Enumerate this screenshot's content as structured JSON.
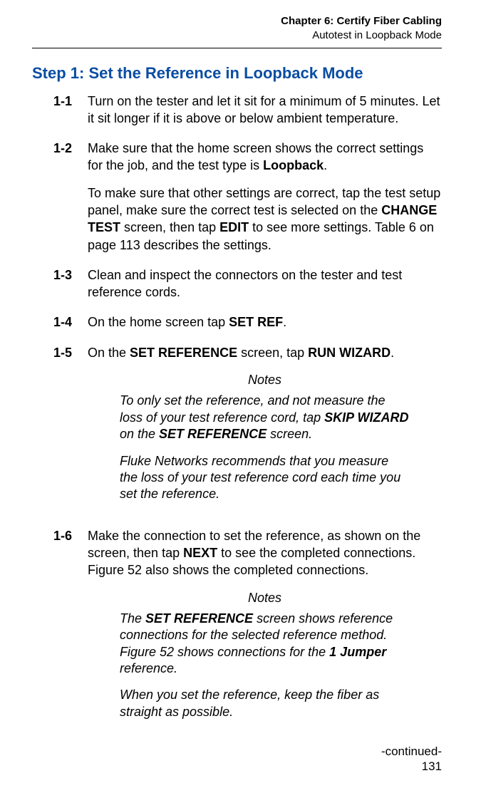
{
  "header": {
    "chapter": "Chapter 6: Certify Fiber Cabling",
    "section": "Autotest in Loopback Mode"
  },
  "title": "Step 1: Set the Reference in Loopback Mode",
  "steps": {
    "s1": {
      "num": "1-1",
      "p1": "Turn on the tester and let it sit for a minimum of 5 minutes. Let it sit longer if it is above or below ambient temperature."
    },
    "s2": {
      "num": "1-2",
      "p1a": "Make sure that the home screen shows the correct settings for the job, and the test type is ",
      "p1b": "Loopback",
      "p1c": ".",
      "p2a": "To make sure that other settings are correct, tap the test setup panel, make sure the correct test is selected on the ",
      "p2b": "CHANGE TEST",
      "p2c": " screen, then tap ",
      "p2d": "EDIT",
      "p2e": " to see more settings. Table 6 on page 113 describes the settings."
    },
    "s3": {
      "num": "1-3",
      "p1": "Clean and inspect the connectors on the tester and test reference cords."
    },
    "s4": {
      "num": "1-4",
      "p1a": "On the home screen tap ",
      "p1b": "SET REF",
      "p1c": "."
    },
    "s5": {
      "num": "1-5",
      "p1a": "On the ",
      "p1b": "SET REFERENCE",
      "p1c": " screen, tap ",
      "p1d": "RUN WIZARD",
      "p1e": "."
    },
    "s6": {
      "num": "1-6",
      "p1a": "Make the connection to set the reference, as shown on the screen, then tap ",
      "p1b": "NEXT",
      "p1c": " to see the completed connections. Figure 52 also shows the completed connections."
    }
  },
  "notes1": {
    "heading": "Notes",
    "p1a": "To only set the reference, and not measure the loss of your test reference cord, tap ",
    "p1b": "SKIP WIZARD",
    "p1c": " on the ",
    "p1d": "SET REFERENCE",
    "p1e": " screen.",
    "p2": "Fluke Networks recommends that you measure the loss of your test reference cord each time you set the reference."
  },
  "notes2": {
    "heading": "Notes",
    "p1a": "The ",
    "p1b": "SET REFERENCE",
    "p1c": " screen shows reference connections for the selected reference method. Figure 52 shows connections for the ",
    "p1d": "1 Jumper",
    "p1e": " reference.",
    "p2": "When you set the reference, keep the fiber as straight as possible."
  },
  "continued": "-continued-",
  "pageNumber": "131"
}
